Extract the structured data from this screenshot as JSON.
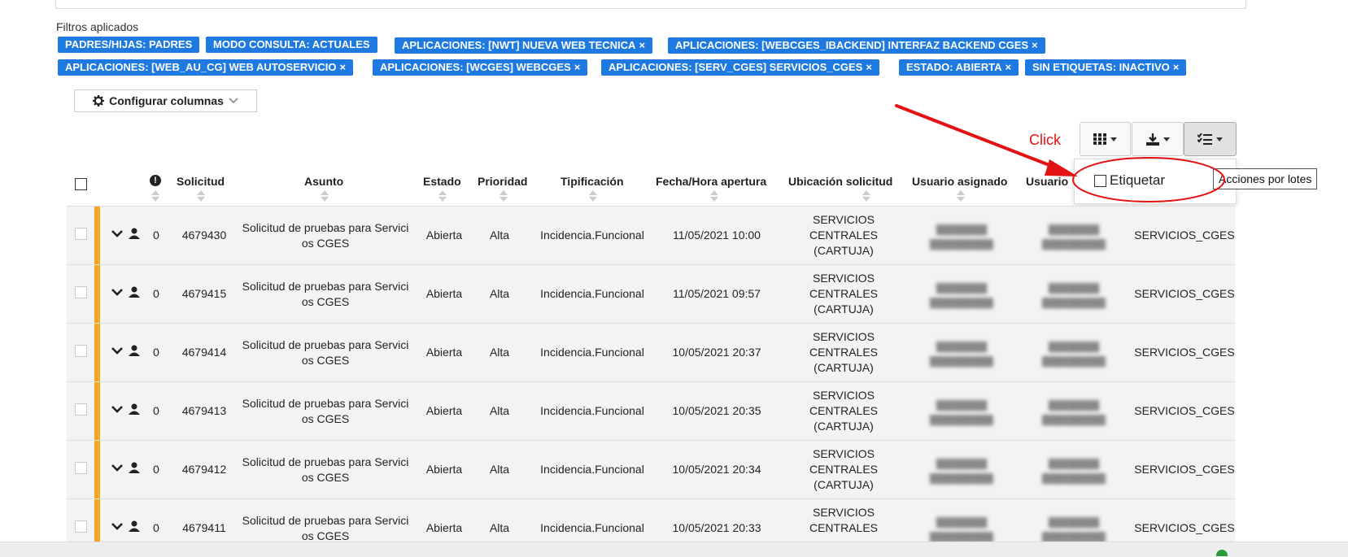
{
  "filters": {
    "label": "Filtros aplicados",
    "chips": [
      {
        "text": "PADRES/HIJAS: PADRES",
        "removable": false
      },
      {
        "text": "MODO CONSULTA: ACTUALES",
        "removable": false
      },
      {
        "text": "APLICACIONES: [NWT] NUEVA WEB TECNICA",
        "removable": true
      },
      {
        "text": "APLICACIONES: [WEBCGES_IBACKEND] INTERFAZ BACKEND CGES",
        "removable": true
      },
      {
        "text": "APLICACIONES: [WEB_AU_CG] WEB AUTOSERVICIO",
        "removable": true
      },
      {
        "text": "APLICACIONES: [WCGES] WEBCGES",
        "removable": true
      },
      {
        "text": "APLICACIONES: [SERV_CGES] SERVICIOS_CGES",
        "removable": true
      },
      {
        "text": "ESTADO: ABIERTA",
        "removable": true
      },
      {
        "text": "SIN ETIQUETAS: INACTIVO",
        "removable": true
      }
    ],
    "remove_glyph": "×"
  },
  "toolbar": {
    "config_columns": "Configurar columnas",
    "annotation": "Click",
    "dropdown_item": "Etiquetar",
    "tooltip": "Acciones por lotes"
  },
  "table": {
    "headers": {
      "solicitud": "Solicitud",
      "asunto": "Asunto",
      "estado": "Estado",
      "prioridad": "Prioridad",
      "tipificacion": "Tipificación",
      "fecha": "Fecha/Hora apertura",
      "ubicacion": "Ubicación solicitud",
      "usuario_asignado": "Usuario asignado",
      "usuario2": "Usuario"
    },
    "rows": [
      {
        "count": "0",
        "id": "4679430",
        "asunto_1": "Solicitud de pruebas para Servici",
        "asunto_2": "os CGES",
        "estado": "Abierta",
        "prioridad": "Alta",
        "tipificacion": "Incidencia.Funcional",
        "fecha": "11/05/2021 10:00",
        "ub1": "SERVICIOS",
        "ub2": "CENTRALES",
        "ub3": "(CARTUJA)",
        "grupo": "SERVICIOS_CGES"
      },
      {
        "count": "0",
        "id": "4679415",
        "asunto_1": "Solicitud de pruebas para Servici",
        "asunto_2": "os CGES",
        "estado": "Abierta",
        "prioridad": "Alta",
        "tipificacion": "Incidencia.Funcional",
        "fecha": "11/05/2021 09:57",
        "ub1": "SERVICIOS",
        "ub2": "CENTRALES",
        "ub3": "(CARTUJA)",
        "grupo": "SERVICIOS_CGES"
      },
      {
        "count": "0",
        "id": "4679414",
        "asunto_1": "Solicitud de pruebas para Servici",
        "asunto_2": "os CGES",
        "estado": "Abierta",
        "prioridad": "Alta",
        "tipificacion": "Incidencia.Funcional",
        "fecha": "10/05/2021 20:37",
        "ub1": "SERVICIOS",
        "ub2": "CENTRALES",
        "ub3": "(CARTUJA)",
        "grupo": "SERVICIOS_CGES"
      },
      {
        "count": "0",
        "id": "4679413",
        "asunto_1": "Solicitud de pruebas para Servici",
        "asunto_2": "os CGES",
        "estado": "Abierta",
        "prioridad": "Alta",
        "tipificacion": "Incidencia.Funcional",
        "fecha": "10/05/2021 20:35",
        "ub1": "SERVICIOS",
        "ub2": "CENTRALES",
        "ub3": "(CARTUJA)",
        "grupo": "SERVICIOS_CGES"
      },
      {
        "count": "0",
        "id": "4679412",
        "asunto_1": "Solicitud de pruebas para Servici",
        "asunto_2": "os CGES",
        "estado": "Abierta",
        "prioridad": "Alta",
        "tipificacion": "Incidencia.Funcional",
        "fecha": "10/05/2021 20:34",
        "ub1": "SERVICIOS",
        "ub2": "CENTRALES",
        "ub3": "(CARTUJA)",
        "grupo": "SERVICIOS_CGES"
      },
      {
        "count": "0",
        "id": "4679411",
        "asunto_1": "Solicitud de pruebas para Servici",
        "asunto_2": "os CGES",
        "estado": "Abierta",
        "prioridad": "Alta",
        "tipificacion": "Incidencia.Funcional",
        "fecha": "10/05/2021 20:33",
        "ub1": "SERVICIOS",
        "ub2": "CENTRALES",
        "ub3": "",
        "grupo": "SERVICIOS_CGES"
      }
    ]
  },
  "colors": {
    "chip": "#1e7ae0",
    "stripe": "#f5a623",
    "annotation": "#e41212"
  },
  "icons": [
    "gear-icon",
    "chevron-down-icon",
    "grid-icon",
    "download-icon",
    "checklist-icon",
    "alert-icon",
    "user-icon"
  ]
}
